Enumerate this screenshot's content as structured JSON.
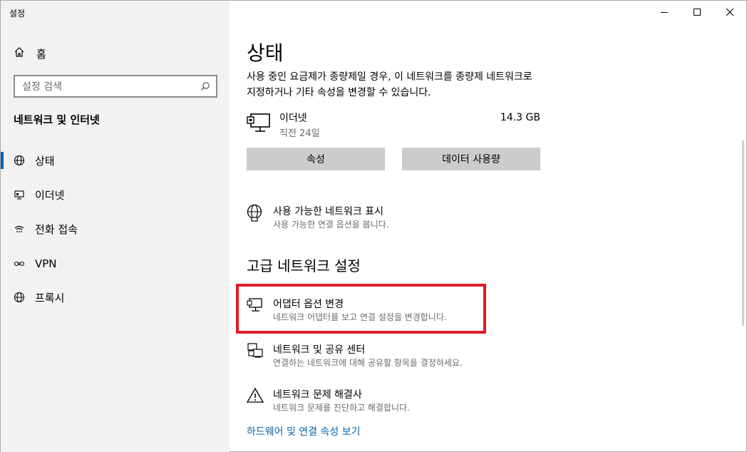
{
  "window": {
    "title": "설정"
  },
  "sidebar": {
    "home_label": "홈",
    "search_placeholder": "설정 검색",
    "section_title": "네트워크 및 인터넷",
    "items": [
      {
        "label": "상태",
        "icon": "globe-icon",
        "active": true
      },
      {
        "label": "이더넷",
        "icon": "ethernet-icon"
      },
      {
        "label": "전화 접속",
        "icon": "dialup-icon"
      },
      {
        "label": "VPN",
        "icon": "vpn-icon"
      },
      {
        "label": "프록시",
        "icon": "globe-icon"
      }
    ]
  },
  "main": {
    "title": "상태",
    "description": "사용 중인 요금제가 종량제일 경우, 이 네트워크를 종량제 네트워크로 지정하거나 기타 속성을 변경할 수 있습니다.",
    "connection": {
      "name": "이더넷",
      "time": "직전 24일",
      "data": "14.3 GB"
    },
    "buttons": {
      "properties": "속성",
      "data_usage": "데이터 사용량"
    },
    "show_networks": {
      "title": "사용 가능한 네트워크 표시",
      "subtitle": "사용 가능한 연결 옵션을 봅니다."
    },
    "advanced_heading": "고급 네트워크 설정",
    "advanced": [
      {
        "title": "어댑터 옵션 변경",
        "subtitle": "네트워크 어댑터를 보고 연결 설정을 변경합니다."
      },
      {
        "title": "네트워크 및 공유 센터",
        "subtitle": "연결하는 네트워크에 대해 공유할 항목을 결정하세요."
      },
      {
        "title": "네트워크 문제 해결사",
        "subtitle": "네트워크 문제를 진단하고 해결합니다."
      }
    ],
    "hardware_link": "하드웨어 및 연결 속성 보기"
  },
  "colors": {
    "accent": "#0063b1",
    "highlight": "#e21c24",
    "sidebar_bg": "#f2f2f2",
    "button_bg": "#cccccc"
  }
}
